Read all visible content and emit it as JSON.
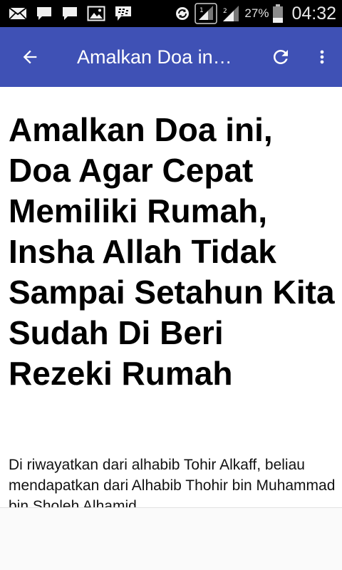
{
  "status_bar": {
    "battery_percent": "27%",
    "time": "04:32",
    "icons": [
      "email-icon",
      "chat-bubble-icon",
      "chat-bubble-icon",
      "image-icon",
      "bbm-icon",
      "sync-icon",
      "signal-icon",
      "signal-icon",
      "battery-icon"
    ]
  },
  "app_bar": {
    "title": "Amalkan Doa in…",
    "color": "#3f51b5",
    "icons": [
      "arrow-back-icon",
      "refresh-icon",
      "more-vert-icon"
    ]
  },
  "article": {
    "title": "Amalkan Doa ini, Doa Agar Cepat Memiliki Rumah, Insha Allah Tidak Sampai Setahun Kita Sudah Di Beri Rezeki Rumah",
    "body": "Di riwayatkan dari alhabib Tohir Alkaff, beliau mendapatkan dari Alhabib Thohir bin Muhammad bin Sholeh Alhamid"
  }
}
